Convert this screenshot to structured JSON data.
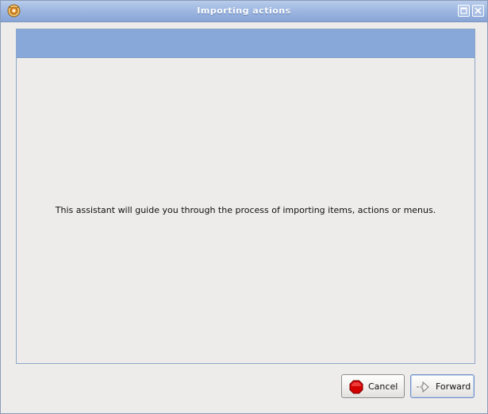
{
  "window": {
    "title": "Importing actions"
  },
  "assistant": {
    "intro_text": "This assistant will guide you through the process of importing items, actions or menus."
  },
  "buttons": {
    "cancel_label": "Cancel",
    "forward_label": "Forward"
  },
  "icons": {
    "app": "nautilus-actions-icon",
    "maximize": "maximize-icon",
    "close": "close-icon",
    "cancel": "stop-icon",
    "forward": "forward-arrow-icon"
  },
  "colors": {
    "titlebar": "#9fb8e2",
    "header_band": "#87a8d9",
    "background": "#edecea",
    "cancel_red": "#d40000"
  }
}
